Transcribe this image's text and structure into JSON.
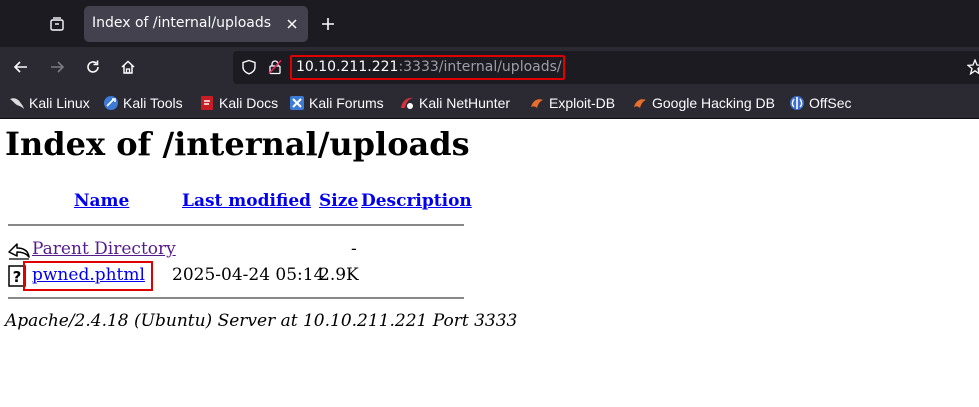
{
  "browser": {
    "tab": {
      "title": "Index of /internal/uploads"
    },
    "url": {
      "host": "10.10.211.221",
      "rest": ":3333/internal/uploads/"
    },
    "bookmarks": [
      {
        "label": "Kali Linux",
        "icon": "kali-dragon-icon"
      },
      {
        "label": "Kali Tools",
        "icon": "kali-tools-icon"
      },
      {
        "label": "Kali Docs",
        "icon": "kali-docs-icon"
      },
      {
        "label": "Kali Forums",
        "icon": "kali-forums-icon"
      },
      {
        "label": "Kali NetHunter",
        "icon": "kali-nethunter-icon"
      },
      {
        "label": "Exploit-DB",
        "icon": "exploit-db-icon"
      },
      {
        "label": "Google Hacking DB",
        "icon": "ghdb-icon"
      },
      {
        "label": "OffSec",
        "icon": "offsec-icon"
      }
    ]
  },
  "page": {
    "title": "Index of /internal/uploads",
    "columns": {
      "name": "Name",
      "modified": "Last modified",
      "size": "Size",
      "description": "Description"
    },
    "rows": [
      {
        "name": "Parent Directory",
        "modified": "",
        "size": "-",
        "icon": "back-arrow-icon"
      },
      {
        "name": "pwned.phtml",
        "modified": "2025-04-24 05:14",
        "size": "2.9K",
        "icon": "unknown-file-icon"
      }
    ],
    "footer": "Apache/2.4.18 (Ubuntu) Server at 10.10.211.221 Port 3333"
  },
  "colors": {
    "highlight": "#e00000",
    "link": "#0000ee",
    "visited": "#551a8b",
    "chrome_bg": "#2b2a33",
    "tabbar_bg": "#1c1b22"
  }
}
